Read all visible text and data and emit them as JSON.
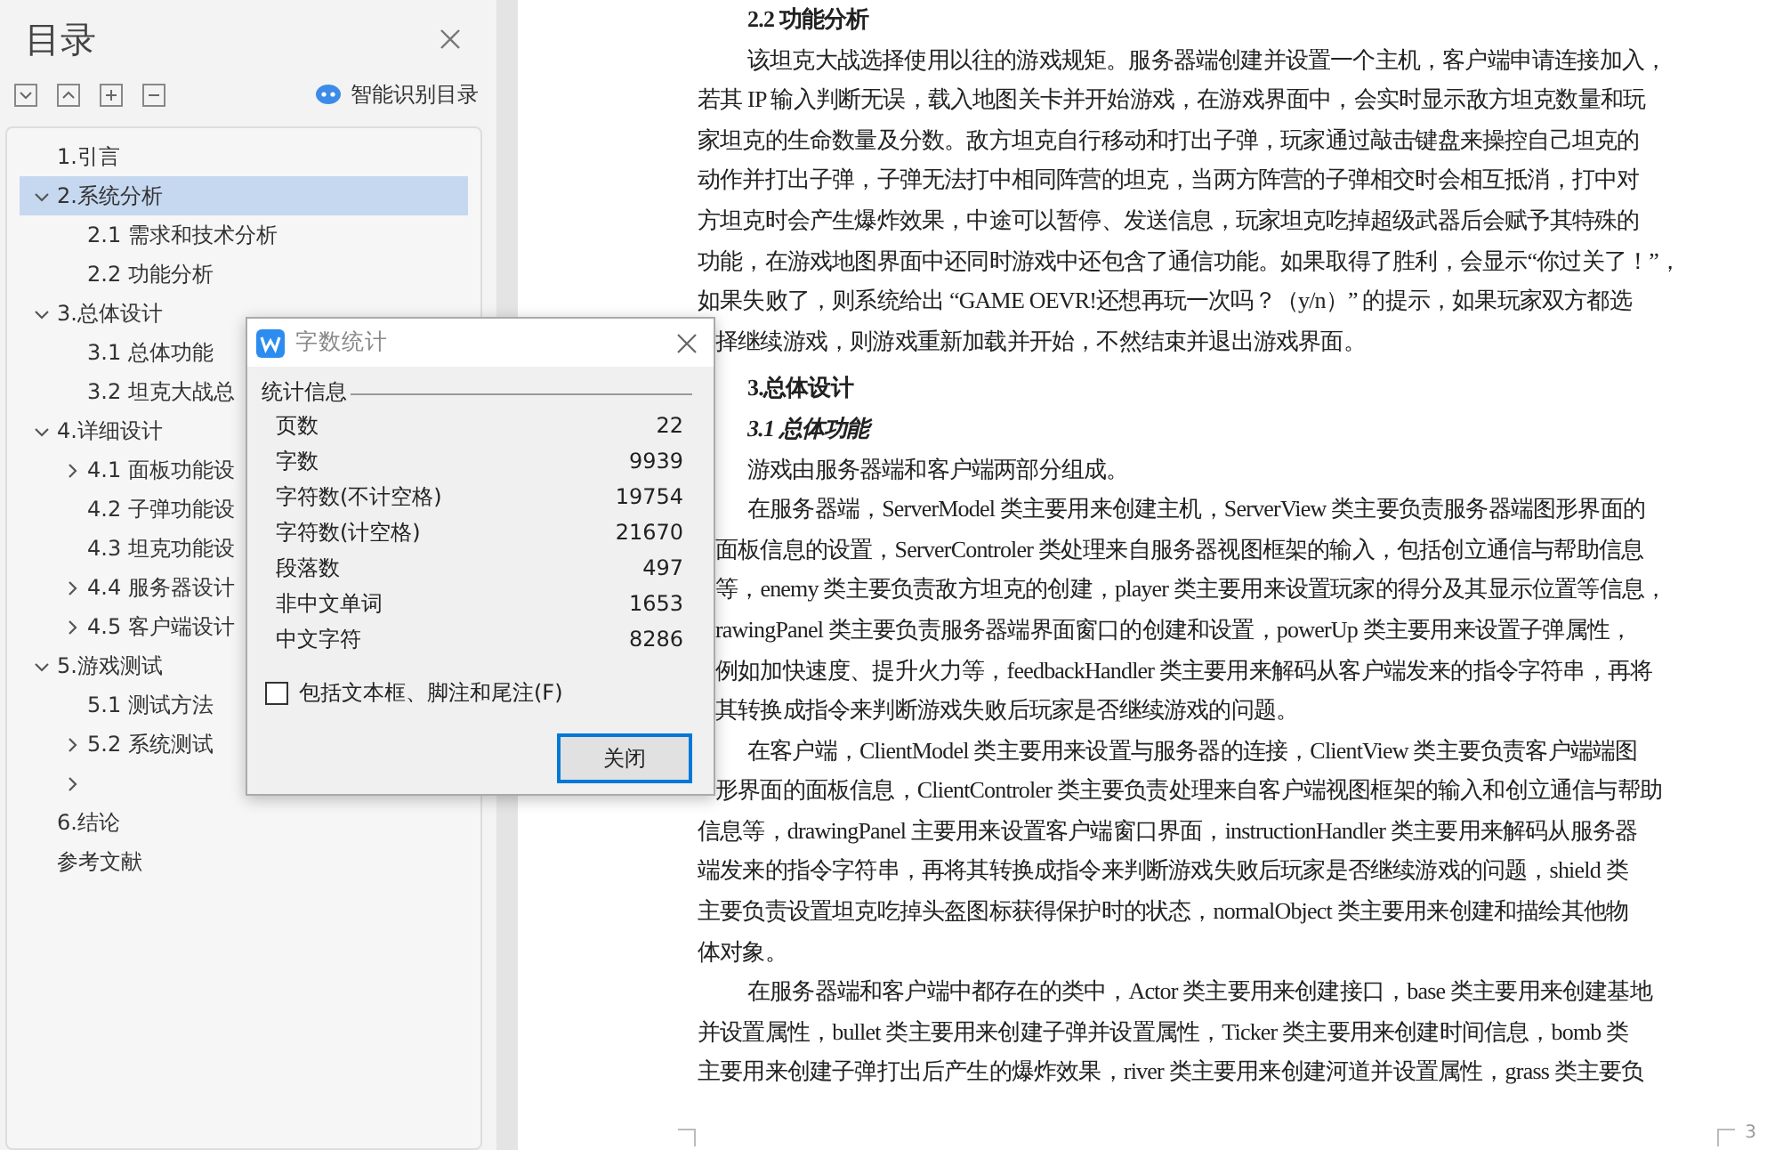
{
  "toc_panel": {
    "title": "目录",
    "smart_button": "智能识别目录",
    "items": [
      {
        "label": "1.引言",
        "selected": false
      },
      {
        "label": "2.系统分析",
        "selected": true,
        "expanded": true,
        "children": [
          {
            "label": "2.1  需求和技术分析",
            "selected": false
          },
          {
            "label": "2.2  功能分析",
            "selected": false
          }
        ]
      },
      {
        "label": "3.总体设计",
        "selected": false,
        "expanded": true,
        "children": [
          {
            "label": "3.1  总体功能",
            "selected": false
          },
          {
            "label": "3.2  坦克大战总",
            "selected": false
          }
        ]
      },
      {
        "label": "4.详细设计",
        "selected": false,
        "expanded": true,
        "children": [
          {
            "label": "4.1  面板功能设",
            "selected": false,
            "expanded": false
          },
          {
            "label": "4.2 子弹功能设",
            "selected": false
          },
          {
            "label": "4.3 坦克功能设",
            "selected": false
          },
          {
            "label": "4.4 服务器设计",
            "selected": false,
            "expanded": false
          },
          {
            "label": "4.5  客户端设计",
            "selected": false,
            "expanded": false
          }
        ]
      },
      {
        "label": "5.游戏测试",
        "selected": false,
        "expanded": true,
        "children": [
          {
            "label": "5.1  测试方法",
            "selected": false
          },
          {
            "label": "5.2  系统测试",
            "selected": false,
            "expanded": false
          },
          {
            "selected": false,
            "expanded": false
          }
        ]
      },
      {
        "label": "6.结论",
        "selected": false
      },
      {
        "label": "参考文献",
        "selected": false
      }
    ]
  },
  "document": {
    "page_number": "3",
    "lines": [
      {
        "kind": "heading",
        "text": "2.2  功能分析",
        "indent": true,
        "cut": false
      },
      {
        "kind": "line",
        "text": "该坦克大战选择使用以往的游戏规矩。服务器端创建并设置一个主机，客户端申请连接加入，",
        "indent": true,
        "cut": false
      },
      {
        "kind": "line",
        "text": "若其 IP 输入判断无误，载入地图关卡并开始游戏，在游戏界面中，会实时显示敌方坦克数量和玩",
        "indent": false,
        "cut": false
      },
      {
        "kind": "line",
        "text": "家坦克的生命数量及分数。敌方坦克自行移动和打出子弹，玩家通过敲击键盘来操控自己坦克的",
        "indent": false,
        "cut": false
      },
      {
        "kind": "line",
        "text": "动作并打出子弹，子弹无法打中相同阵营的坦克，当两方阵营的子弹相交时会相互抵消，打中对",
        "indent": false,
        "cut": false
      },
      {
        "kind": "line",
        "text": "方坦克时会产生爆炸效果，中途可以暂停、发送信息，玩家坦克吃掉超级武器后会赋予其特殊的",
        "indent": false,
        "cut": false
      },
      {
        "kind": "line",
        "text": "功能，在游戏地图界面中还同时游戏中还包含了通信功能。如果取得了胜利，会显示“你过关了！”，",
        "indent": false,
        "cut": false
      },
      {
        "kind": "line",
        "text": "如果失败了，则系统给出 “GAME OEVR!还想再玩一次吗？（y/n）” 的提示，如果玩家双方都选",
        "indent": false,
        "cut": false
      },
      {
        "kind": "line",
        "text": "择继续游戏，则游戏重新加载并开始，不然结束并退出游戏界面。",
        "indent": false,
        "cut": true
      },
      {
        "kind": "heading",
        "text": "3.总体设计",
        "indent": true,
        "cut": false
      },
      {
        "kind": "subheading",
        "text": "3.1  总体功能",
        "indent": true,
        "cut": false
      },
      {
        "kind": "line",
        "text": "游戏由服务器端和客户端两部分组成。",
        "indent": true,
        "cut": false
      },
      {
        "kind": "line",
        "text": "在服务器端，ServerModel 类主要用来创建主机，ServerView 类主要负责服务器端图形界面的",
        "indent": true,
        "cut": false
      },
      {
        "kind": "line",
        "text": "面板信息的设置，ServerControler 类处理来自服务器视图框架的输入，包括创立通信与帮助信息",
        "indent": false,
        "cut": true
      },
      {
        "kind": "line",
        "text": "等，enemy 类主要负责敌方坦克的创建，player 类主要用来设置玩家的得分及其显示位置等信息，",
        "indent": false,
        "cut": true
      },
      {
        "kind": "line",
        "text": "rawingPanel 类主要负责服务器端界面窗口的创建和设置，powerUp 类主要用来设置子弹属性，",
        "indent": false,
        "cut": true
      },
      {
        "kind": "line",
        "text": "例如加快速度、提升火力等，feedbackHandler 类主要用来解码从客户端发来的指令字符串，再将",
        "indent": false,
        "cut": true
      },
      {
        "kind": "line",
        "text": "其转换成指令来判断游戏失败后玩家是否继续游戏的问题。",
        "indent": false,
        "cut": true
      },
      {
        "kind": "line",
        "text": "在客户端，ClientModel 类主要用来设置与服务器的连接，ClientView 类主要负责客户端端图",
        "indent": true,
        "cut": false
      },
      {
        "kind": "line",
        "text": "形界面的面板信息，ClientControler 类主要负责处理来自客户端视图框架的输入和创立通信与帮助",
        "indent": false,
        "cut": true
      },
      {
        "kind": "line",
        "text": "信息等，drawingPanel 主要用来设置客户端窗口界面，instructionHandler 类主要用来解码从服务器",
        "indent": false,
        "cut": false
      },
      {
        "kind": "line",
        "text": "端发来的指令字符串，再将其转换成指令来判断游戏失败后玩家是否继续游戏的问题，shield 类",
        "indent": false,
        "cut": false
      },
      {
        "kind": "line",
        "text": "主要负责设置坦克吃掉头盔图标获得保护时的状态，normalObject 类主要用来创建和描绘其他物",
        "indent": false,
        "cut": false
      },
      {
        "kind": "line",
        "text": "体对象。",
        "indent": false,
        "cut": false
      },
      {
        "kind": "line",
        "text": "在服务器端和客户端中都存在的类中，Actor 类主要用来创建接口，base 类主要用来创建基地",
        "indent": true,
        "cut": false
      },
      {
        "kind": "line",
        "text": "并设置属性，bullet 类主要用来创建子弹并设置属性，Ticker 类主要用来创建时间信息，bomb 类",
        "indent": false,
        "cut": false
      },
      {
        "kind": "line",
        "text": "主要用来创建子弹打出后产生的爆炸效果，river 类主要用来创建河道并设置属性，grass 类主要负",
        "indent": false,
        "cut": false
      }
    ]
  },
  "dialog": {
    "title": "字数统计",
    "group_label": "统计信息",
    "stats": [
      {
        "label": "页数",
        "value": "22"
      },
      {
        "label": "字数",
        "value": "9939"
      },
      {
        "label": "字符数(不计空格)",
        "value": "19754"
      },
      {
        "label": "字符数(计空格)",
        "value": "21670"
      },
      {
        "label": "段落数",
        "value": "497"
      },
      {
        "label": "非中文单词",
        "value": "1653"
      },
      {
        "label": "中文字符",
        "value": "8286"
      }
    ],
    "include_option": {
      "label": "包括文本框、脚注和尾注(F)",
      "checked": false
    },
    "close_button": {
      "label": "关闭",
      "focused": true
    }
  }
}
